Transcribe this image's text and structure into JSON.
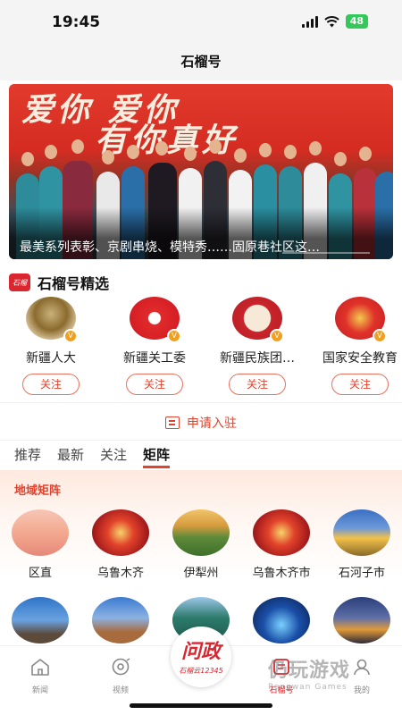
{
  "status_bar": {
    "time": "19:45",
    "battery": "48"
  },
  "header": {
    "title": "石榴号"
  },
  "banner": {
    "slogan_line1": "爱你 爱你",
    "slogan_line2": "有你真好",
    "caption": "最美系列表彰、京剧串烧、模特秀……固原巷社区这…"
  },
  "featured": {
    "title": "石榴号精选",
    "logo_text": "石榴",
    "accounts": [
      {
        "name": "新疆人大",
        "follow": "关注"
      },
      {
        "name": "新疆关工委",
        "follow": "关注"
      },
      {
        "name": "新疆民族团…",
        "follow": "关注"
      },
      {
        "name": "国家安全教育",
        "follow": "关注"
      }
    ]
  },
  "apply_label": "申请入驻",
  "tabs": [
    "推荐",
    "最新",
    "关注",
    "矩阵"
  ],
  "active_tab": "矩阵",
  "region_matrix": {
    "label": "地域矩阵",
    "regions_row1": [
      "区直",
      "乌鲁木齐",
      "伊犁州",
      "乌鲁木齐市",
      "石河子市"
    ],
    "regions_row2": [
      "",
      "",
      "",
      "",
      ""
    ]
  },
  "tabbar": {
    "items": [
      "新闻",
      "视频",
      "石榴号",
      "我的"
    ],
    "center_big": "问政",
    "center_small": "石榴云12345"
  },
  "watermark": {
    "main": "仍玩游戏",
    "sub": "Rengwan Games"
  }
}
